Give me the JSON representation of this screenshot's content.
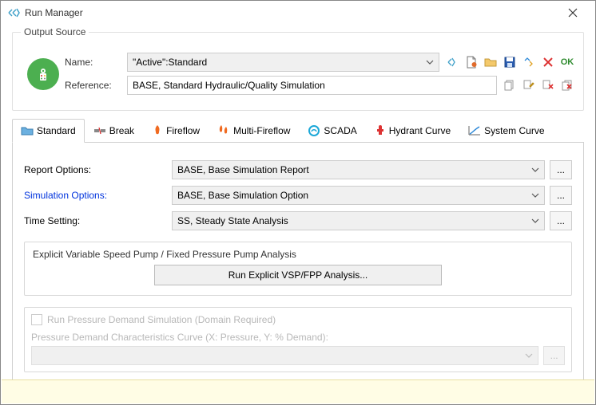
{
  "window": {
    "title": "Run Manager"
  },
  "outputSource": {
    "legend": "Output Source",
    "nameLabel": "Name:",
    "nameValue": "\"Active\":Standard",
    "refLabel": "Reference:",
    "refValue": "BASE, Standard Hydraulic/Quality Simulation",
    "okText": "OK"
  },
  "tabs": [
    {
      "label": "Standard"
    },
    {
      "label": "Break"
    },
    {
      "label": "Fireflow"
    },
    {
      "label": "Multi-Fireflow"
    },
    {
      "label": "SCADA"
    },
    {
      "label": "Hydrant Curve"
    },
    {
      "label": "System Curve"
    }
  ],
  "standard": {
    "reportOptionsLabel": "Report Options:",
    "reportOptionsValue": "BASE, Base Simulation Report",
    "simOptionsLabel": "Simulation Options:",
    "simOptionsValue": "BASE, Base Simulation Option",
    "timeSettingLabel": "Time Setting:",
    "timeSettingValue": "SS, Steady State Analysis",
    "vspGroupTitle": "Explicit Variable Speed Pump / Fixed Pressure Pump Analysis",
    "runVspButton": "Run Explicit VSP/FPP Analysis...",
    "pdCheckboxLabel": "Run Pressure Demand Simulation (Domain Required)",
    "pdCurveLabel": "Pressure Demand Characteristics Curve (X: Pressure, Y: % Demand):"
  },
  "ellipsis": "..."
}
